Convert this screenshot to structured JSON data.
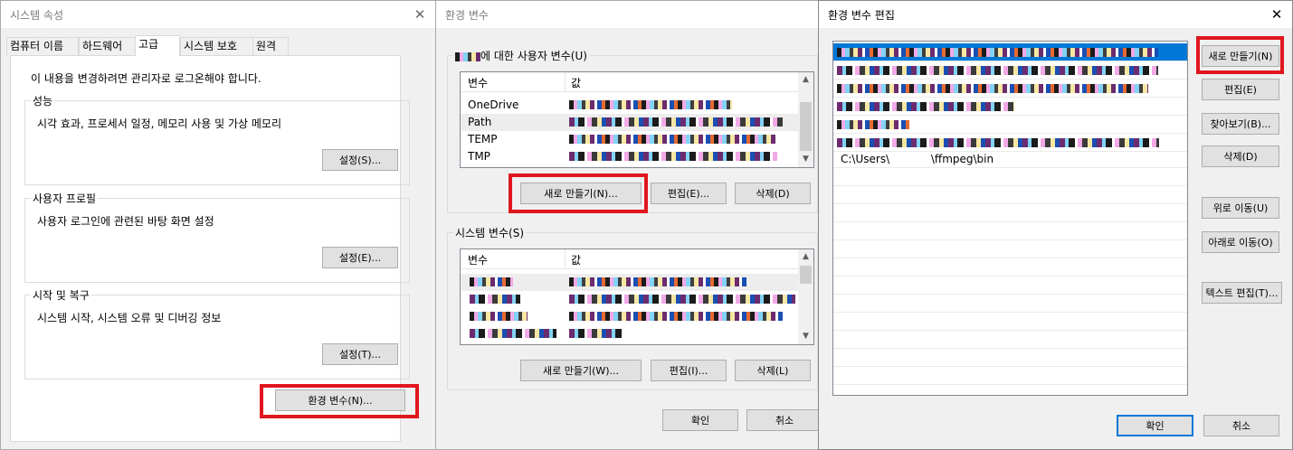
{
  "system_properties": {
    "title": "시스템 속성",
    "tabs": [
      "컴퓨터 이름",
      "하드웨어",
      "고급",
      "시스템 보호",
      "원격"
    ],
    "active_tab": "고급",
    "admin_note": "이 내용을 변경하려면 관리자로 로그온해야 합니다.",
    "groups": [
      {
        "label": "성능",
        "desc": "시각 효과, 프로세서 일정, 메모리 사용 및 가상 메모리",
        "button": "설정(S)..."
      },
      {
        "label": "사용자 프로필",
        "desc": "사용자 로그인에 관련된 바탕 화면 설정",
        "button": "설정(E)..."
      },
      {
        "label": "시작 및 복구",
        "desc": "시스템 시작, 시스템 오류 및 디버깅 정보",
        "button": "설정(T)..."
      }
    ],
    "env_button": "환경 변수(N)..."
  },
  "env_vars": {
    "title": "환경 변수",
    "user_group_label": "에 대한 사용자 변수(U)",
    "columns": [
      "변수",
      "값"
    ],
    "user_vars": [
      {
        "name": "OneDrive"
      },
      {
        "name": "Path"
      },
      {
        "name": "TEMP"
      },
      {
        "name": "TMP"
      }
    ],
    "user_buttons": {
      "new": "새로 만들기(N)...",
      "edit": "편집(E)...",
      "delete": "삭제(D)"
    },
    "system_group_label": "시스템 변수(S)",
    "system_buttons": {
      "new": "새로 만들기(W)...",
      "edit": "편집(I)...",
      "delete": "삭제(L)"
    },
    "ok": "확인",
    "cancel": "취소"
  },
  "edit_env": {
    "title": "환경 변수 편집",
    "new_entry": "C:\\Users\\            \\ffmpeg\\bin",
    "buttons": {
      "new": "새로 만들기(N)",
      "edit": "편집(E)",
      "browse": "찾아보기(B)...",
      "delete": "삭제(D)",
      "move_up": "위로 이동(U)",
      "move_down": "아래로 이동(O)",
      "edit_text": "텍스트 편집(T)..."
    },
    "ok": "확인",
    "cancel": "취소"
  },
  "highlight_color": "#e0161e",
  "accent_color": "#0078d7"
}
